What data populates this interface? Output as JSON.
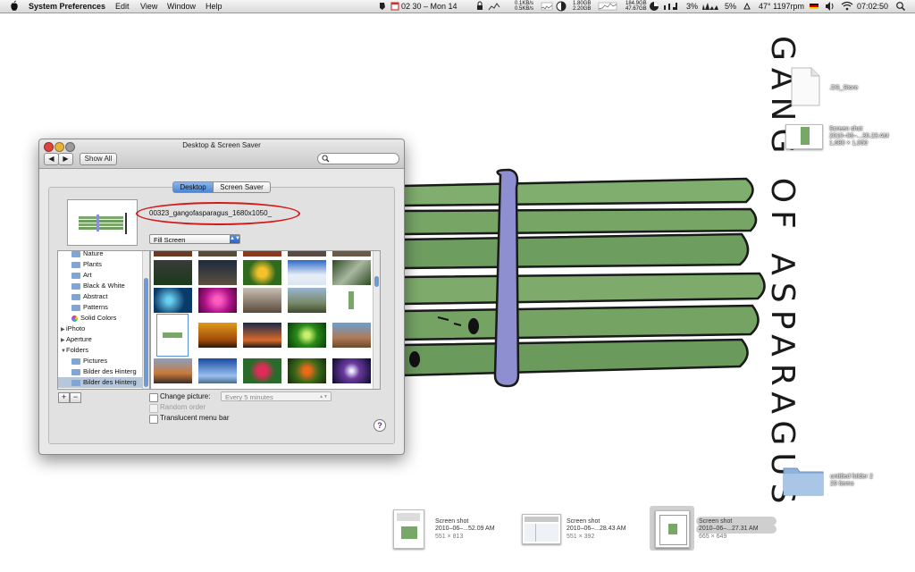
{
  "menubar": {
    "apple": "",
    "app_name": "System Preferences",
    "menus": [
      "Edit",
      "View",
      "Window",
      "Help"
    ],
    "clock": "02 30 – Mon 14",
    "net_up": "0.1KB/s",
    "net_down": "0.5KB/s",
    "mem_a": "1.80GB",
    "mem_b": "2.20GB",
    "disk_a": "184.9GB",
    "disk_b": "47.67GB",
    "cpu1": "3%",
    "cpu2": "5%",
    "temp": "47° 1197rpm",
    "time": "07:02:50"
  },
  "desktop": {
    "icons": [
      {
        "label": ".DS_Store",
        "sub": ""
      },
      {
        "label": "Screen shot",
        "sub": "2010–06–...30.23 AM",
        "sub2": "1,680 × 1,050"
      },
      {
        "label": "untitled folder 2",
        "sub": "29 items"
      }
    ],
    "dock_thumbs": [
      {
        "label": "Screen shot",
        "sub": "2010–06–...52.09 AM",
        "sub2": "551 × 813"
      },
      {
        "label": "Screen shot",
        "sub": "2010–06–...28.43 AM",
        "sub2": "551 × 392"
      },
      {
        "label": "Screen shot",
        "sub": "2010–06–...27.31 AM",
        "sub2": "665 × 649"
      }
    ],
    "wallpaper_text": "GANG OF ASPARAGUS"
  },
  "window": {
    "title": "Desktop & Screen Saver",
    "show_all": "Show All",
    "back": "◀",
    "forward": "▶",
    "tabs": [
      "Desktop",
      "Screen Saver"
    ],
    "filename": "00323_gangofasparagus_1680x1050_",
    "fill_mode": "Fill Screen",
    "sidebar": [
      {
        "label": "Nature",
        "type": "folder"
      },
      {
        "label": "Plants",
        "type": "folder"
      },
      {
        "label": "Art",
        "type": "folder"
      },
      {
        "label": "Black & White",
        "type": "folder"
      },
      {
        "label": "Abstract",
        "type": "folder"
      },
      {
        "label": "Patterns",
        "type": "folder"
      },
      {
        "label": "Solid Colors",
        "type": "color"
      },
      {
        "label": "iPhoto",
        "type": "group"
      },
      {
        "label": "Aperture",
        "type": "group"
      },
      {
        "label": "Folders",
        "type": "group-open"
      },
      {
        "label": "Pictures",
        "type": "folder"
      },
      {
        "label": "Bilder des Hinterg",
        "type": "folder"
      },
      {
        "label": "Bilder des Hinterg",
        "type": "folder-selected"
      }
    ],
    "add": "+",
    "remove": "−",
    "change_picture": "Change picture:",
    "interval": "Every 5 minutes",
    "random_order": "Random order",
    "translucent": "Translucent menu bar",
    "help": "?"
  },
  "colors": {
    "accent": "#3b73d0",
    "ellipse": "#d21a1a",
    "asparagus": "#78a868",
    "band": "#8d8fd0"
  }
}
